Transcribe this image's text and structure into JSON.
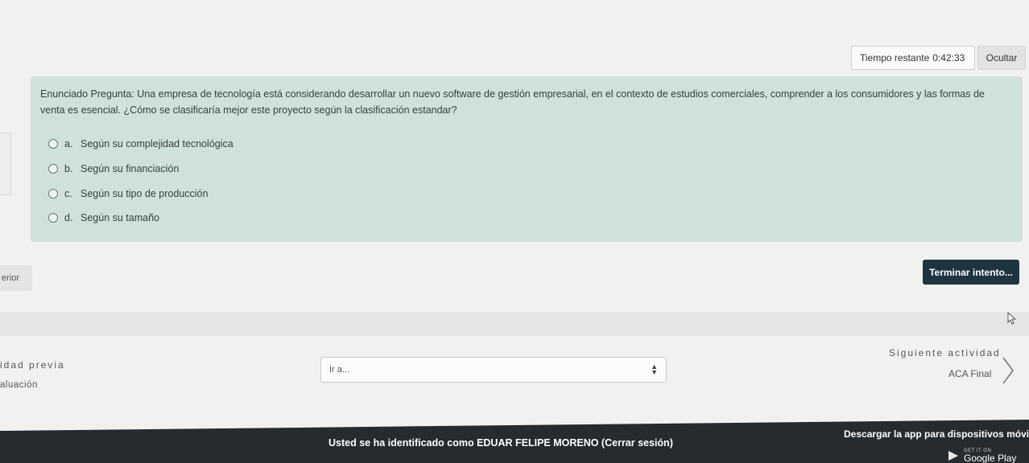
{
  "timer": {
    "label": "Tiempo restante",
    "value": "0:42:33"
  },
  "hide_button": "Ocultar",
  "question": {
    "text": "Enunciado Pregunta: Una empresa de tecnología está considerando desarrollar un nuevo software de gestión empresarial, en el contexto de estudios comerciales, comprender a los consumidores y las formas de venta es esencial. ¿Cómo se clasificaría mejor este proyecto según la clasificación estandar?",
    "options": [
      {
        "letter": "a.",
        "text": "Según su complejidad tecnológica"
      },
      {
        "letter": "b.",
        "text": "Según su financiación"
      },
      {
        "letter": "c.",
        "text": "Según su tipo de producción"
      },
      {
        "letter": "d.",
        "text": "Según su tamaño"
      }
    ]
  },
  "prev_page_button": "erior",
  "finish_button": "Terminar intento...",
  "activity_nav": {
    "prev_label": "idad previa",
    "prev_name": "aluación",
    "jump_placeholder": "Ir a...",
    "next_label": "Siguiente actividad",
    "next_name": "ACA Final"
  },
  "footer": {
    "logged_in": "Usted se ha identificado como EDUAR FELIPE MORENO (Cerrar sesión)",
    "app_link": "Descargar la app para dispositivos móviles",
    "store_small": "GET IT ON",
    "store_big": "Google Play"
  },
  "colors": {
    "question_bg": "#cfe2da",
    "finish_bg": "#1f3441",
    "footer_bg": "#262b2f"
  }
}
